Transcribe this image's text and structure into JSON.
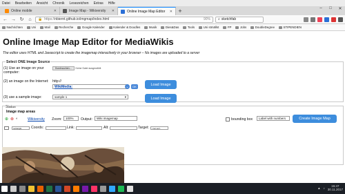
{
  "menubar": [
    "Datei",
    "Bearbeiten",
    "Ansicht",
    "Chronik",
    "Lesezeichen",
    "Extras",
    "Hilfe"
  ],
  "tabs": [
    {
      "label": "Online mobile",
      "active": false,
      "color": "#ff8a00"
    },
    {
      "label": "Image Map - Wikiversity",
      "active": false,
      "color": "#555555"
    },
    {
      "label": "Online Image Map Editor",
      "active": true,
      "color": "#2b6fd6"
    }
  ],
  "newtab": "+",
  "winctl": [
    "–",
    "□",
    "✕"
  ],
  "nav": {
    "back": "←",
    "forward": "→",
    "reload": "↻",
    "home": "⌂",
    "url_scheme": "https://",
    "url_rest": "nbiernt.github.io/imgmap/index.html",
    "url_end": "90%",
    "search_value": "sketchfab"
  },
  "bookmarks": [
    "Nachrichten",
    "Uni",
    "Mail",
    "Recherche",
    "Google Kalender",
    "Kalender & Doodles",
    "Musik",
    "Dies&Das",
    "Tools",
    "Uni stmällst",
    "FP",
    "Jobs",
    "DoubleDegree",
    "STIPENDIEN"
  ],
  "page": {
    "title": "Online Image Map Editor for MediaWikis",
    "subtitle": "The editor uses HTML and Javascript to create the imagemap interactively in your browser – No images are uploaded to a server",
    "legend": "Select ONE Image Source",
    "row1_label": "(1) Use an image on your computer:",
    "browse_label": "Durchsuchen...",
    "no_file": "Keine Datei ausgewählt",
    "row2_label": "(2) an image on the Internet:",
    "row2_prefix": "http://",
    "row2_value": "WikiMedia:",
    "ok_label": "OK",
    "load_label": "Load Image",
    "row3_label": "(3) use a sample image:",
    "sample_value": "sample 1",
    "status_label": "Status",
    "areas_label": "Image map areas",
    "wikiversity": "Wikiversity",
    "zoom_label": "Zoom:",
    "zoom_value": "100%",
    "output_label": "Output:",
    "output_value": "Wiki imagemap",
    "bounding_label": "bounding box",
    "label_with_numbers": "Label with numbers",
    "create_label": "Create Image Map",
    "shape_value": "rectangle",
    "coords_label": "Coords:",
    "link_label": "Link:",
    "alt_label": "Alt:",
    "target_label": "Target:",
    "target_value": "<not set>"
  },
  "taskbar": {
    "icons": [
      {
        "name": "windows-start",
        "color": "#ffffff"
      },
      {
        "name": "search",
        "color": "#cccccc"
      },
      {
        "name": "task-view",
        "color": "#888888"
      },
      {
        "name": "file-explorer",
        "color": "#f1c232"
      },
      {
        "name": "firefox",
        "color": "#e66000"
      },
      {
        "name": "excel",
        "color": "#1f7244"
      },
      {
        "name": "word",
        "color": "#2b579a"
      },
      {
        "name": "powerpoint",
        "color": "#d24726"
      },
      {
        "name": "illustrator",
        "color": "#ff7c00"
      },
      {
        "name": "onenote",
        "color": "#7719aa"
      },
      {
        "name": "indesign",
        "color": "#ff3366"
      },
      {
        "name": "app-gray",
        "color": "#999999"
      },
      {
        "name": "photoshop",
        "color": "#31a8ff"
      },
      {
        "name": "spotify",
        "color": "#1db954"
      },
      {
        "name": "app-white",
        "color": "#e0e0e0"
      }
    ],
    "time": "15:47",
    "date": "30.11.2017"
  }
}
